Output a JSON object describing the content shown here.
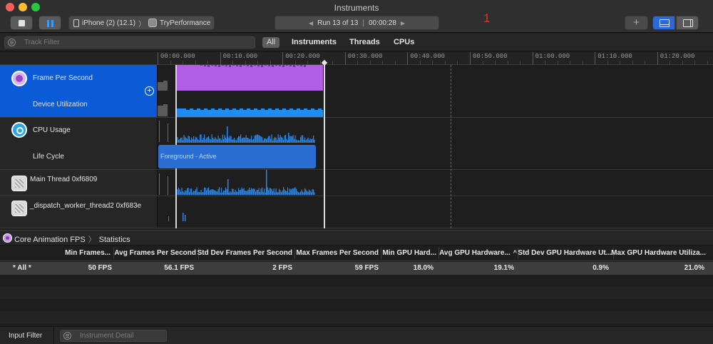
{
  "window": {
    "title": "Instruments"
  },
  "toolbar": {
    "device": "iPhone (2) (12.1)",
    "app": "TryPerformance",
    "run": "Run 13 of 13",
    "time": "00:00:28",
    "marker": "1"
  },
  "filter": {
    "placeholder": "Track Filter",
    "scopes": [
      "All",
      "Instruments",
      "Threads",
      "CPUs"
    ]
  },
  "ruler": {
    "ticks": [
      "00:00.000",
      "00:10.000",
      "00:20.000",
      "00:30.000",
      "00:40.000",
      "00:50.000",
      "01:00.000",
      "01:10.000",
      "01:20.000"
    ]
  },
  "tracks": {
    "fps_label": "Frame Per Second",
    "device_util_label": "Device Utilization",
    "cpu_label": "CPU Usage",
    "lifecycle_label": "Life Cycle",
    "lifecycle_state": "Foreground - Active",
    "main_thread_label": "Main Thread  0xf6809",
    "worker_thread_label": "_dispatch_worker_thread2  0xf683e"
  },
  "detail": {
    "instrument": "Core Animation FPS",
    "view": "Statistics",
    "columns": [
      "Min Frames...",
      "Avg Frames Per Second",
      "Std Dev Frames Per Second",
      "Max Frames Per Second",
      "Min GPU Hard...",
      "Avg GPU Hardware...",
      "Std Dev GPU Hardware Ut...",
      "Max GPU Hardware Utiliza..."
    ],
    "row": {
      "name": "* All *",
      "values": [
        "50 FPS",
        "56.1 FPS",
        "2 FPS",
        "59 FPS",
        "18.0%",
        "19.1%",
        "0.9%",
        "21.0%"
      ]
    }
  },
  "bottom": {
    "input_filter": "Input Filter",
    "detail_placeholder": "Instrument Detail"
  },
  "colors": {
    "fps_track": "#b15ee6",
    "utilization_track": "#1f8cf0",
    "cpu_track": "#2a88ec",
    "selection": "#0c5bd6"
  }
}
